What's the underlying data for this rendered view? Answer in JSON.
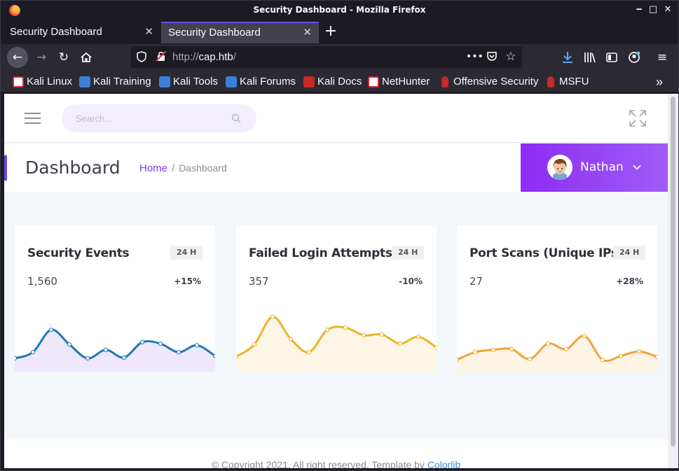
{
  "window": {
    "title": "Security Dashboard - Mozilla Firefox"
  },
  "tabs": [
    {
      "label": "Security Dashboard",
      "active": false
    },
    {
      "label": "Security Dashboard",
      "active": true
    }
  ],
  "url": {
    "protocol": "http://",
    "host": "cap.htb",
    "path": "/"
  },
  "bookmarks": [
    {
      "label": "Kali Linux",
      "icon": "kali-icon",
      "color": "#d7283a"
    },
    {
      "label": "Kali Training",
      "icon": "kali-training-icon",
      "color": "#3d7ed8"
    },
    {
      "label": "Kali Tools",
      "icon": "kali-tools-icon",
      "color": "#3d7ed8"
    },
    {
      "label": "Kali Forums",
      "icon": "kali-forums-icon",
      "color": "#3d7ed8"
    },
    {
      "label": "Kali Docs",
      "icon": "kali-docs-icon",
      "color": "#c82828"
    },
    {
      "label": "NetHunter",
      "icon": "nethunter-icon",
      "color": "#d7283a"
    },
    {
      "label": "Offensive Security",
      "icon": "offsec-icon",
      "color": "#c82828"
    },
    {
      "label": "MSFU",
      "icon": "msfu-icon",
      "color": "#c82828"
    }
  ],
  "search": {
    "placeholder": "Search..."
  },
  "header": {
    "title": "Dashboard",
    "breadcrumb_home": "Home",
    "breadcrumb_sep": "/",
    "breadcrumb_current": "Dashboard"
  },
  "user": {
    "name": "Nathan"
  },
  "cards": [
    {
      "title": "Security Events",
      "badge": "24 H",
      "value": "1,560",
      "change": "+15%",
      "line_color": "#1e78b5",
      "fill_color": "#efe7fc",
      "points": [
        10,
        18,
        47,
        28,
        10,
        21,
        11,
        31,
        29,
        18,
        27,
        13
      ]
    },
    {
      "title": "Failed Login Attempts",
      "badge": "24 H",
      "value": "357",
      "change": "-10%",
      "line_color": "#ecb42a",
      "fill_color": "#fdf6e6",
      "points": [
        12,
        28,
        64,
        35,
        18,
        47,
        50,
        40,
        41,
        29,
        38,
        24
      ]
    },
    {
      "title": "Port Scans (Unique IPs)",
      "badge": "24 H",
      "value": "27",
      "change": "+28%",
      "line_color": "#f2a335",
      "fill_color": "#fdf4e6",
      "points": [
        8,
        18,
        21,
        22,
        9,
        29,
        22,
        39,
        8,
        13,
        19,
        12
      ]
    }
  ],
  "footer": {
    "text": "© Copyright 2021. All right reserved. Template by ",
    "link": "Colorlib"
  }
}
